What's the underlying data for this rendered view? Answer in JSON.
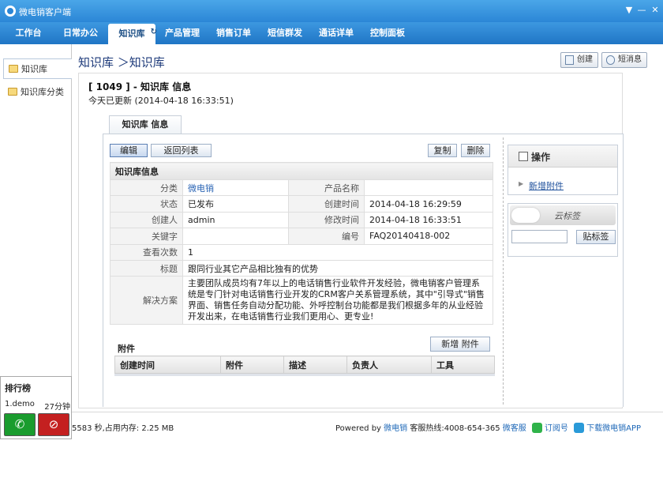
{
  "app": {
    "title": "微电销客户端",
    "window_controls": [
      "▼",
      "—",
      "✕"
    ]
  },
  "nav": {
    "tabs": [
      {
        "label": "工作台"
      },
      {
        "label": "日常办公"
      },
      {
        "label": "知识库",
        "active": true
      },
      {
        "label": "产品管理"
      },
      {
        "label": "销售订单"
      },
      {
        "label": "短信群发"
      },
      {
        "label": "通话详单"
      },
      {
        "label": "控制面板"
      }
    ]
  },
  "sidebar": {
    "items": [
      {
        "label": "知识库",
        "active": true
      },
      {
        "label": "知识库分类"
      }
    ]
  },
  "ranking": {
    "title": "排行榜",
    "rows": [
      {
        "name": "1.demo",
        "time": "27分钟"
      }
    ]
  },
  "main": {
    "breadcrumb": "知识库 ＞知识库",
    "create_button": "创建",
    "sms_button": "短消息",
    "record_title": "[ 1049 ] - 知识库  信息",
    "record_subtitle": "今天已更新 (2014-04-18 16:33:51)",
    "tab_label": "知识库  信息",
    "buttons": {
      "edit": "编辑",
      "back": "返回列表",
      "copy": "复制",
      "delete": "删除"
    },
    "section_header": "知识库信息",
    "fields": {
      "category_label": "分类",
      "category_value": "微电销",
      "product_label": "产品名称",
      "product_value": "",
      "status_label": "状态",
      "status_value": "已发布",
      "created_label": "创建时间",
      "created_value": "2014-04-18 16:29:59",
      "creator_label": "创建人",
      "creator_value": "admin",
      "modified_label": "修改时间",
      "modified_value": "2014-04-18 16:33:51",
      "keyword_label": "关键字",
      "keyword_value": "",
      "number_label": "编号",
      "number_value": "FAQ20140418-002",
      "views_label": "查看次数",
      "views_value": "1",
      "subject_label": "标题",
      "subject_value": "跟同行业其它产品相比独有的优势",
      "solution_label": "解决方案",
      "solution_value": "主要团队成员均有7年以上的电话销售行业软件开发经验，微电销客户管理系统是专门针对电话销售行业开发的CRM客户关系管理系统，其中\"引导式\"销售界面、销售任务自动分配功能、外呼控制台功能都是我们根据多年的从业经验开发出来，在电话销售行业我们更用心、更专业!"
    },
    "attachments": {
      "title": "附件",
      "add_button": "新增 附件",
      "columns": [
        "创建时间",
        "附件",
        "描述",
        "负责人",
        "工具"
      ]
    },
    "operations": {
      "title": "操作",
      "add_attachment_link": "新增附件"
    },
    "tags": {
      "title": "贴标签",
      "cloud_text": "云标签",
      "input_value": "",
      "button": "贴标签"
    }
  },
  "status": {
    "memory": "5583 秒,占用内存: 2.25 MB",
    "powered_by": "Powered by",
    "brand": "微电销",
    "hotline": "客服热线:4008-654-365",
    "service": "微客服",
    "subscribe": "订阅号",
    "download": "下载微电销APP"
  },
  "colors": {
    "titlebar": "#2b86d6",
    "navbar": "#1f75c5",
    "link": "#2a64b4",
    "call_green": "#1a9c2e",
    "call_red": "#c42020"
  }
}
